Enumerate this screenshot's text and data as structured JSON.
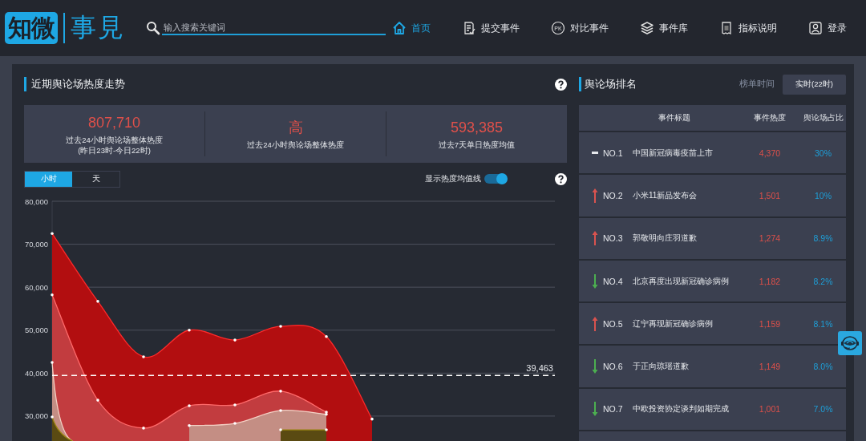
{
  "header": {
    "logo": {
      "mark": "知微",
      "name": "事見"
    },
    "search": {
      "placeholder": "输入搜索关键词"
    },
    "nav": [
      {
        "label": "首页",
        "selected": true
      },
      {
        "label": "提交事件",
        "selected": false
      },
      {
        "label": "对比事件",
        "selected": false,
        "icon_text": "PK"
      },
      {
        "label": "事件库",
        "selected": false
      },
      {
        "label": "指标说明",
        "selected": false
      },
      {
        "label": "登录",
        "selected": false
      }
    ]
  },
  "trend_panel": {
    "title": "近期舆论场热度走势",
    "stats": [
      {
        "value": "807,710",
        "label": "过去24小时舆论场整体热度",
        "note": "(昨日23时-今日22时)"
      },
      {
        "value": "高",
        "label": "过去24小时舆论场整体热度"
      },
      {
        "value": "593,385",
        "label": "过去7天单日热度均值"
      }
    ],
    "granularity": [
      {
        "label": "小时",
        "selected": true
      },
      {
        "label": "天",
        "selected": false
      }
    ],
    "average_toggle": {
      "label": "显示热度均值线",
      "on": true
    },
    "chart_data": {
      "type": "area",
      "stacked": false,
      "grid": true,
      "categories": [
        null,
        null,
        null,
        null,
        null,
        null,
        null,
        null,
        null,
        null,
        null,
        null
      ],
      "ylim": [
        24200,
        80000
      ],
      "yticks": [
        {
          "value": 80000,
          "label": "80,000"
        },
        {
          "value": 70000,
          "label": "70,000"
        },
        {
          "value": 60000,
          "label": "60,000"
        },
        {
          "value": 50000,
          "label": "50,000"
        },
        {
          "value": 40000,
          "label": "40,000"
        },
        {
          "value": 30000,
          "label": "30,000"
        }
      ],
      "series": [
        {
          "color": "#b20e10",
          "values": [
            72500,
            56700,
            43800,
            50000,
            47700,
            50900,
            48500,
            29300,
            null,
            null,
            null,
            null
          ]
        },
        {
          "color": "#c23c3f",
          "values": [
            58200,
            33700,
            27200,
            32400,
            32600,
            35800,
            30900,
            null,
            null,
            null,
            null,
            null
          ]
        },
        {
          "color": "#c48e84",
          "values": [
            42500,
            null,
            null,
            27800,
            28300,
            31300,
            30400,
            null,
            null,
            null,
            null,
            null
          ]
        },
        {
          "color": "#5a4a12",
          "values": [
            29800,
            null,
            null,
            null,
            null,
            26800,
            26800,
            null,
            null,
            null,
            null,
            null
          ]
        }
      ],
      "ref_lines": [
        {
          "axis": "y",
          "value": 39463,
          "label": "39,463"
        }
      ]
    }
  },
  "ranking_panel": {
    "title": "舆论场排名",
    "time_label": "榜单时间",
    "time_button": "实时(22时)",
    "columns": [
      "事件标题",
      "事件热度",
      "舆论场占比"
    ],
    "rows": [
      {
        "rank_up": false,
        "rank_down": false,
        "rank": "NO.1",
        "title": "中国新冠病毒疫苗上市",
        "heat": "4,370",
        "share": "30%"
      },
      {
        "rank_up": true,
        "rank_down": false,
        "rank": "NO.2",
        "title": "小米11新品发布会",
        "heat": "1,501",
        "share": "10%"
      },
      {
        "rank_up": true,
        "rank_down": false,
        "rank": "NO.3",
        "title": "郭敬明向庄羽道歉",
        "heat": "1,274",
        "share": "8.9%"
      },
      {
        "rank_up": false,
        "rank_down": true,
        "rank": "NO.4",
        "title": "北京再度出现新冠确诊病例",
        "heat": "1,182",
        "share": "8.2%"
      },
      {
        "rank_up": true,
        "rank_down": false,
        "rank": "NO.5",
        "title": "辽宁再现新冠确诊病例",
        "heat": "1,159",
        "share": "8.1%"
      },
      {
        "rank_up": false,
        "rank_down": true,
        "rank": "NO.6",
        "title": "于正向琼瑶道歉",
        "heat": "1,149",
        "share": "8.0%"
      },
      {
        "rank_up": false,
        "rank_down": true,
        "rank": "NO.7",
        "title": "中欧投资协定谈判如期完成",
        "heat": "1,001",
        "share": "7.0%"
      }
    ]
  }
}
